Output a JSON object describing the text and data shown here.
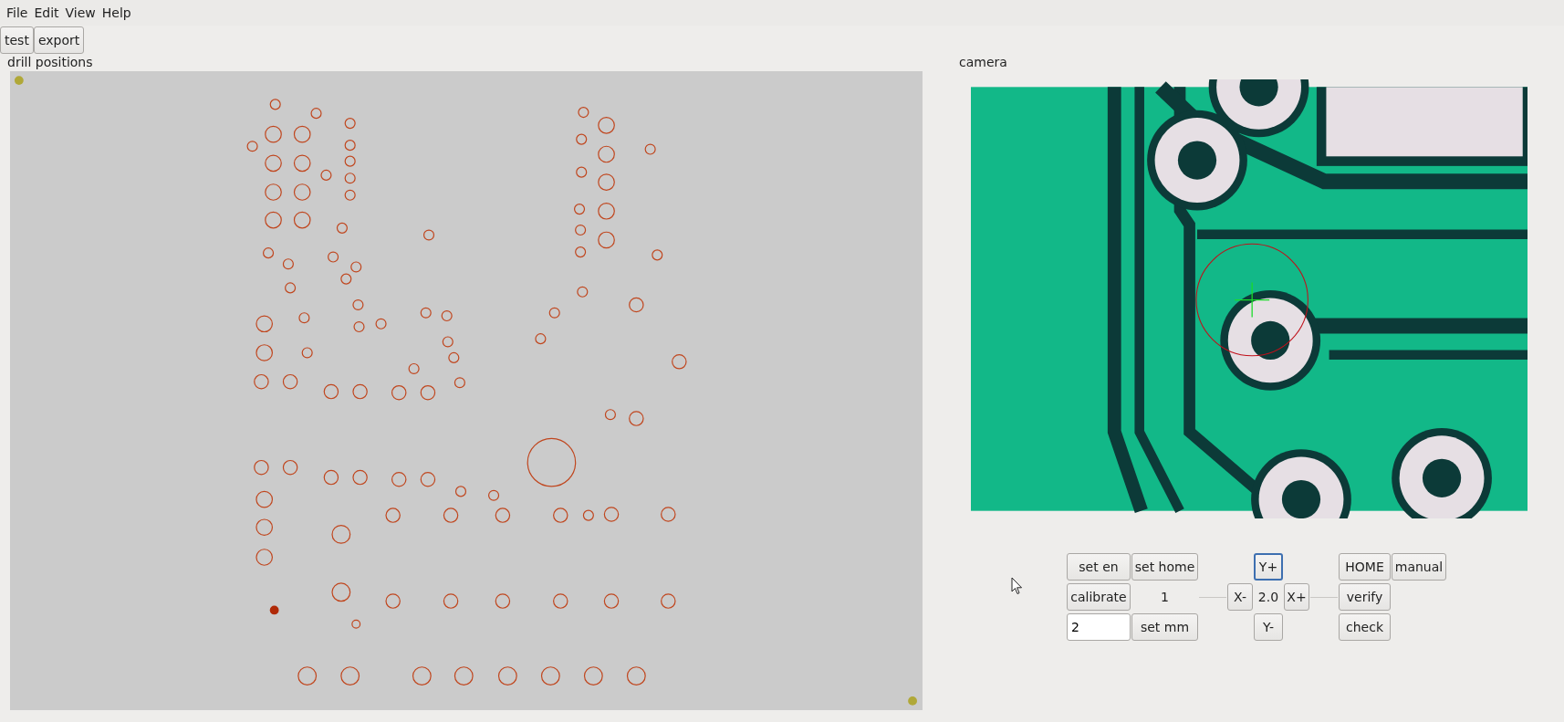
{
  "menu": [
    "File",
    "Edit",
    "View",
    "Help"
  ],
  "toolbar": [
    "test",
    "export"
  ],
  "drill_panel": {
    "title": "drill positions"
  },
  "camera_panel": {
    "title": "camera"
  },
  "controls": [
    {
      "kind": "button",
      "label": "set en",
      "focused": false
    },
    {
      "kind": "button",
      "label": "set home",
      "focused": false
    },
    {
      "kind": "button",
      "label": "Y+",
      "focused": true
    },
    {
      "kind": "button",
      "label": "HOME",
      "focused": false
    },
    {
      "kind": "button",
      "label": "manual",
      "focused": false
    },
    {
      "kind": "button",
      "label": "calibrate",
      "focused": false
    },
    {
      "kind": "label",
      "label": "1"
    },
    {
      "kind": "button",
      "label": "X-",
      "focused": false
    },
    {
      "kind": "label",
      "label": "2.0"
    },
    {
      "kind": "button",
      "label": "X+",
      "focused": false
    },
    {
      "kind": "button",
      "label": "verify",
      "focused": false
    },
    {
      "kind": "input",
      "value": "2"
    },
    {
      "kind": "button",
      "label": "set mm",
      "focused": false
    },
    {
      "kind": "button",
      "label": "Y-",
      "focused": false
    },
    {
      "kind": "button",
      "label": "check",
      "focused": false
    }
  ]
}
